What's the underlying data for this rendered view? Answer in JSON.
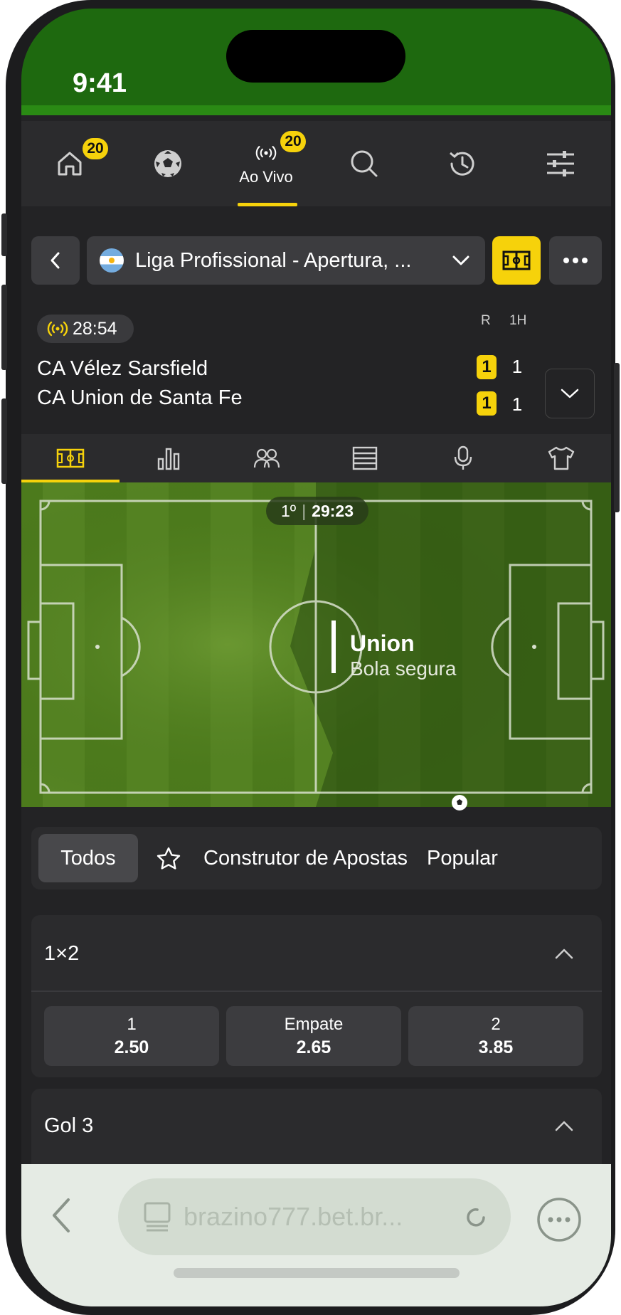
{
  "status_bar": {
    "time": "9:41"
  },
  "top_nav": {
    "items": [
      {
        "name": "home",
        "icon": "home-icon",
        "badge": "20"
      },
      {
        "name": "sports",
        "icon": "soccer-ball-icon"
      },
      {
        "name": "live",
        "icon": "live-signal-icon",
        "badge": "20",
        "label": "Ao Vivo",
        "active": true
      },
      {
        "name": "search",
        "icon": "search-icon"
      },
      {
        "name": "history",
        "icon": "history-icon"
      },
      {
        "name": "settings",
        "icon": "sliders-icon"
      }
    ]
  },
  "league": {
    "name": "Liga Profissional - Apertura, ...",
    "flag": "argentina-flag"
  },
  "match": {
    "live_time": "28:54",
    "col_r": "R",
    "col_1h": "1H",
    "home": {
      "name": "CA Vélez Sarsfield",
      "score": "1",
      "score_1h": "1"
    },
    "away": {
      "name": "CA Union de Santa Fe",
      "score": "1",
      "score_1h": "1"
    }
  },
  "match_tabs": [
    "field-icon",
    "stats-icon",
    "lineups-icon",
    "table-icon",
    "commentary-icon",
    "shirt-icon"
  ],
  "pitch": {
    "period": "1º",
    "clock": "29:23",
    "team": "Union",
    "event": "Bola segura"
  },
  "filters": {
    "items": [
      "Todos",
      "Construtor de Apostas",
      "Popular"
    ],
    "favorite_icon": "star-icon"
  },
  "markets": [
    {
      "title": "1×2",
      "odds": [
        {
          "label": "1",
          "value": "2.50"
        },
        {
          "label": "Empate",
          "value": "2.65"
        },
        {
          "label": "2",
          "value": "3.85"
        }
      ]
    },
    {
      "title": "Gol 3"
    }
  ],
  "browser": {
    "url": "brazino777.bet.br..."
  },
  "colors": {
    "accent": "#f6d20b",
    "status_green": "#1e690f",
    "background": "#232325"
  }
}
